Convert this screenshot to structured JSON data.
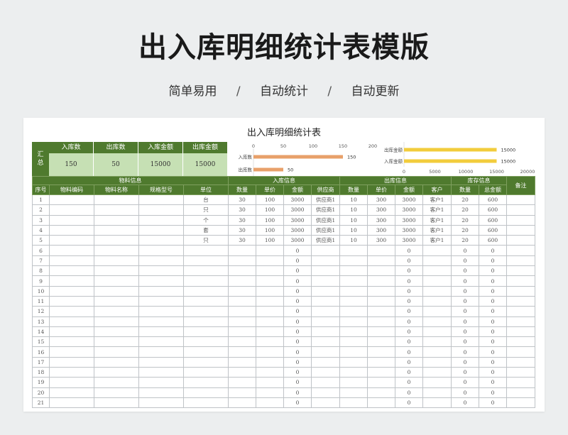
{
  "page": {
    "title": "出入库明细统计表模版",
    "subtitle": [
      "简单易用",
      "自动统计",
      "自动更新"
    ],
    "separator": "/"
  },
  "sheet": {
    "title": "出入库明细统计表",
    "summary": {
      "label": "汇\n总",
      "headers": [
        "入库数",
        "出库数",
        "入库金额",
        "出库金额"
      ],
      "values": [
        "150",
        "50",
        "15000",
        "15000"
      ]
    },
    "groups": [
      "物料信息",
      "入库信息",
      "出库信息",
      "库存信息"
    ],
    "columns": [
      "序号",
      "物料编码",
      "物料名称",
      "规格型号",
      "单位",
      "数量",
      "单价",
      "金额",
      "供应商",
      "数量",
      "单价",
      "金额",
      "客户",
      "数量",
      "总金额",
      "备注"
    ],
    "rows": [
      [
        "1",
        "",
        "",
        "",
        "台",
        "30",
        "100",
        "3000",
        "供应商1",
        "10",
        "300",
        "3000",
        "客户1",
        "20",
        "600",
        ""
      ],
      [
        "2",
        "",
        "",
        "",
        "只",
        "30",
        "100",
        "3000",
        "供应商1",
        "10",
        "300",
        "3000",
        "客户1",
        "20",
        "600",
        ""
      ],
      [
        "3",
        "",
        "",
        "",
        "个",
        "30",
        "100",
        "3000",
        "供应商1",
        "10",
        "300",
        "3000",
        "客户1",
        "20",
        "600",
        ""
      ],
      [
        "4",
        "",
        "",
        "",
        "套",
        "30",
        "100",
        "3000",
        "供应商1",
        "10",
        "300",
        "3000",
        "客户1",
        "20",
        "600",
        ""
      ],
      [
        "5",
        "",
        "",
        "",
        "只",
        "30",
        "100",
        "3000",
        "供应商1",
        "10",
        "300",
        "3000",
        "客户1",
        "20",
        "600",
        ""
      ],
      [
        "6",
        "",
        "",
        "",
        "",
        "",
        "",
        "0",
        "",
        "",
        "",
        "0",
        "",
        "0",
        "0",
        ""
      ],
      [
        "7",
        "",
        "",
        "",
        "",
        "",
        "",
        "0",
        "",
        "",
        "",
        "0",
        "",
        "0",
        "0",
        ""
      ],
      [
        "8",
        "",
        "",
        "",
        "",
        "",
        "",
        "0",
        "",
        "",
        "",
        "0",
        "",
        "0",
        "0",
        ""
      ],
      [
        "9",
        "",
        "",
        "",
        "",
        "",
        "",
        "0",
        "",
        "",
        "",
        "0",
        "",
        "0",
        "0",
        ""
      ],
      [
        "10",
        "",
        "",
        "",
        "",
        "",
        "",
        "0",
        "",
        "",
        "",
        "0",
        "",
        "0",
        "0",
        ""
      ],
      [
        "11",
        "",
        "",
        "",
        "",
        "",
        "",
        "0",
        "",
        "",
        "",
        "0",
        "",
        "0",
        "0",
        ""
      ],
      [
        "12",
        "",
        "",
        "",
        "",
        "",
        "",
        "0",
        "",
        "",
        "",
        "0",
        "",
        "0",
        "0",
        ""
      ],
      [
        "13",
        "",
        "",
        "",
        "",
        "",
        "",
        "0",
        "",
        "",
        "",
        "0",
        "",
        "0",
        "0",
        ""
      ],
      [
        "14",
        "",
        "",
        "",
        "",
        "",
        "",
        "0",
        "",
        "",
        "",
        "0",
        "",
        "0",
        "0",
        ""
      ],
      [
        "15",
        "",
        "",
        "",
        "",
        "",
        "",
        "0",
        "",
        "",
        "",
        "0",
        "",
        "0",
        "0",
        ""
      ],
      [
        "16",
        "",
        "",
        "",
        "",
        "",
        "",
        "0",
        "",
        "",
        "",
        "0",
        "",
        "0",
        "0",
        ""
      ],
      [
        "17",
        "",
        "",
        "",
        "",
        "",
        "",
        "0",
        "",
        "",
        "",
        "0",
        "",
        "0",
        "0",
        ""
      ],
      [
        "18",
        "",
        "",
        "",
        "",
        "",
        "",
        "0",
        "",
        "",
        "",
        "0",
        "",
        "0",
        "0",
        ""
      ],
      [
        "19",
        "",
        "",
        "",
        "",
        "",
        "",
        "0",
        "",
        "",
        "",
        "0",
        "",
        "0",
        "0",
        ""
      ],
      [
        "20",
        "",
        "",
        "",
        "",
        "",
        "",
        "0",
        "",
        "",
        "",
        "0",
        "",
        "0",
        "0",
        ""
      ],
      [
        "21",
        "",
        "",
        "",
        "",
        "",
        "",
        "0",
        "",
        "",
        "",
        "0",
        "",
        "0",
        "0",
        ""
      ]
    ]
  },
  "chart_data": [
    {
      "type": "bar",
      "orientation": "horizontal",
      "categories": [
        "入库数",
        "出库数"
      ],
      "values": [
        150,
        50
      ],
      "xlim": [
        0,
        200
      ],
      "xticks": [
        0,
        50,
        100,
        150,
        200
      ],
      "color": "#e8a06a"
    },
    {
      "type": "bar",
      "orientation": "horizontal",
      "categories": [
        "出库金额",
        "入库金额"
      ],
      "values": [
        15000,
        15000
      ],
      "xlim": [
        0,
        20000
      ],
      "xticks": [
        0,
        5000,
        10000,
        15000,
        20000
      ],
      "color": "#f2cc3c"
    }
  ],
  "colors": {
    "header_green": "#4f7a2e",
    "summary_light": "#c6e0b4",
    "grid_line": "#bfc3c7"
  }
}
